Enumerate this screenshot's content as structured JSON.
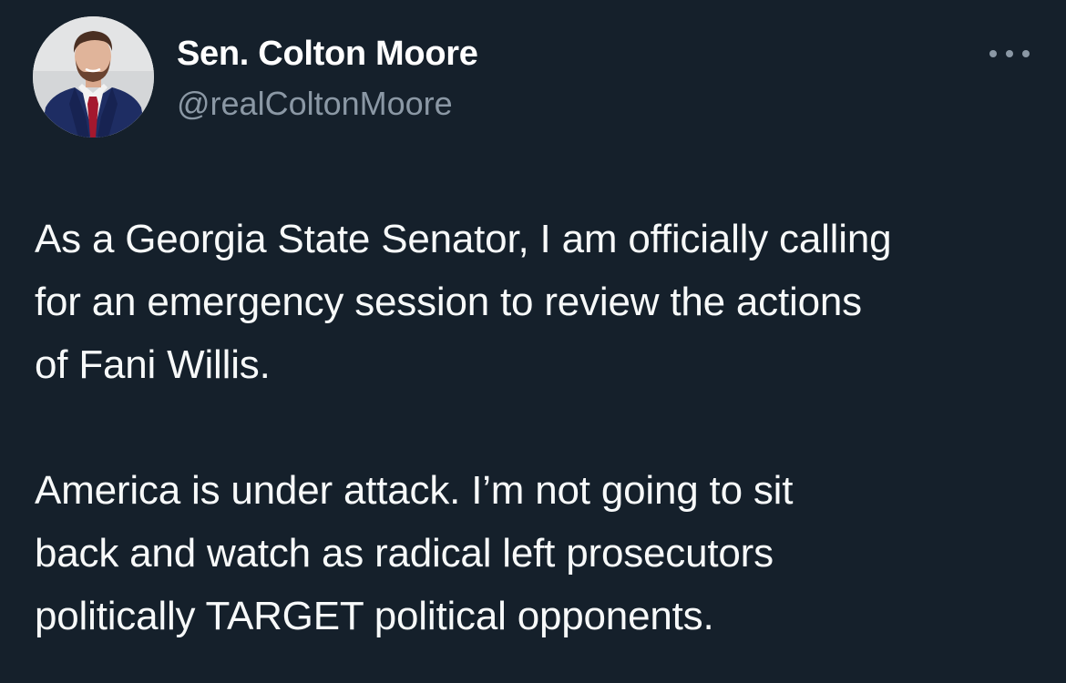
{
  "author": {
    "display_name": "Sen. Colton Moore",
    "handle": "@realColtonMoore",
    "avatar_icon": "profile-photo"
  },
  "more_icon": "more-options-icon",
  "tweet": {
    "paragraphs": [
      {
        "lines": [
          "As a Georgia State Senator, I am officially calling",
          "for an emergency session to review the actions",
          "of Fani Willis."
        ]
      },
      {
        "lines": [
          "America is under attack. I’m not going to sit",
          "back and watch as radical left prosecutors",
          "politically TARGET political opponents."
        ]
      }
    ]
  },
  "colors": {
    "background": "#15202b",
    "primary_text": "#f7f9f9",
    "secondary_text": "#8b98a5"
  }
}
